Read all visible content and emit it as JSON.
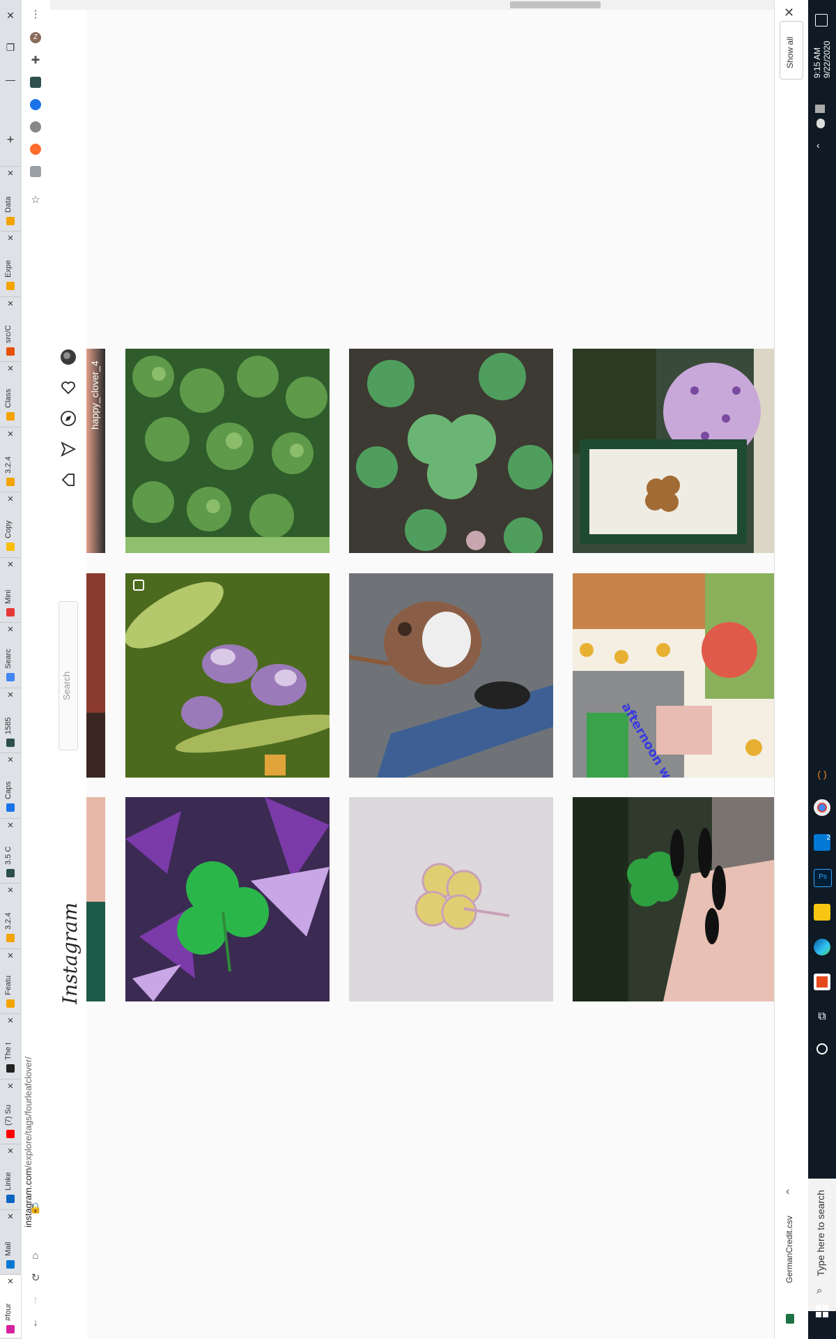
{
  "browser": {
    "tabs": [
      {
        "title": "#four",
        "color": "#d6249f",
        "active": true
      },
      {
        "title": "Mail",
        "color": "#0078d4"
      },
      {
        "title": "Linke",
        "color": "#0a66c2"
      },
      {
        "title": "(7) Su",
        "color": "#ff0000"
      },
      {
        "title": "The t",
        "color": "#222222"
      },
      {
        "title": "Featu",
        "color": "#f4a300"
      },
      {
        "title": "3.2.4",
        "color": "#f4a300"
      },
      {
        "title": "3.5 C",
        "color": "#2f4f4f"
      },
      {
        "title": "Caps",
        "color": "#1a73e8"
      },
      {
        "title": "1585",
        "color": "#2f4f4f"
      },
      {
        "title": "Searc",
        "color": "#4285f4"
      },
      {
        "title": "Mini",
        "color": "#e53935"
      },
      {
        "title": "Copy",
        "color": "#fbbc04"
      },
      {
        "title": "3.2.4",
        "color": "#f4a300"
      },
      {
        "title": "Class",
        "color": "#f4a300"
      },
      {
        "title": "src/C",
        "color": "#e65100"
      },
      {
        "title": "Expe",
        "color": "#f4a300"
      },
      {
        "title": "Data",
        "color": "#f4a300"
      }
    ],
    "url_domain": "instagram.com",
    "url_path": "/explore/tags/fourleafclover/",
    "profile_initial": "Z"
  },
  "instagram": {
    "logo": "Instagram",
    "search_placeholder": "Search",
    "first_tile_caption": "happy_clover_4",
    "collage_caption": "afternoon walk"
  },
  "downloads": {
    "show_all": "Show all",
    "file_name": "GermanCredit.csv"
  },
  "taskbar": {
    "search_placeholder": "Type here to search",
    "time": "9:15 AM",
    "date": "9/22/2020",
    "mail_badge": "2"
  }
}
